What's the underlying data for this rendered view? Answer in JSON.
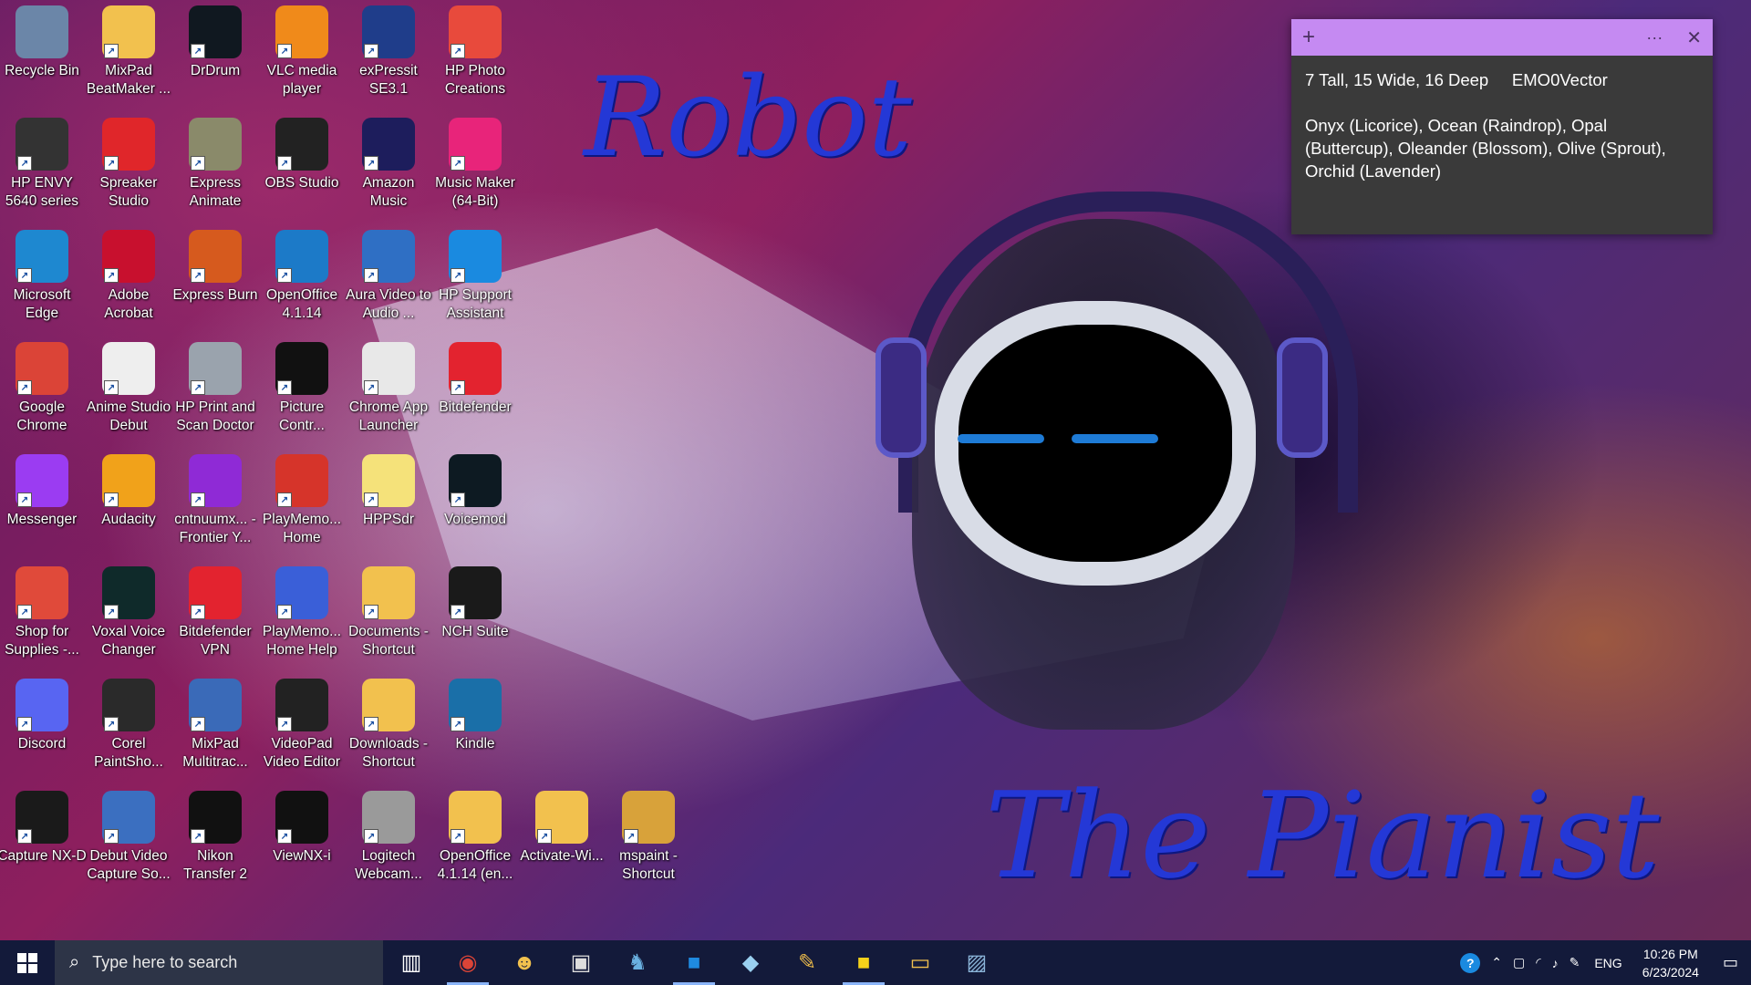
{
  "desktop": {
    "icons": [
      {
        "label": "Recycle Bin",
        "icon": "recycle-bin-icon",
        "color": "#6b86a8"
      },
      {
        "label": "MixPad BeatMaker ...",
        "icon": "folder-icon",
        "color": "#f2c14e"
      },
      {
        "label": "DrDrum",
        "icon": "drdrum-icon",
        "color": "#101820"
      },
      {
        "label": "VLC media player",
        "icon": "vlc-cone-icon",
        "color": "#f08a1a"
      },
      {
        "label": "exPressit SE3.1",
        "icon": "expressit-icon",
        "color": "#1f3d8a"
      },
      {
        "label": "HP Photo Creations",
        "icon": "hp-photo-icon",
        "color": "#e84a3c"
      },
      {
        "label": "HP ENVY 5640 series",
        "icon": "printer-icon",
        "color": "#333333"
      },
      {
        "label": "Spreaker Studio",
        "icon": "rec-icon",
        "color": "#e0262a"
      },
      {
        "label": "Express Animate",
        "icon": "express-animate-icon",
        "color": "#8a8a6a"
      },
      {
        "label": "OBS Studio",
        "icon": "obs-icon",
        "color": "#222222"
      },
      {
        "label": "Amazon Music",
        "icon": "amazon-music-icon",
        "color": "#1d1d5c"
      },
      {
        "label": "Music Maker (64-Bit)",
        "icon": "music-maker-icon",
        "color": "#e8247a"
      },
      {
        "label": "Microsoft Edge",
        "icon": "edge-icon",
        "color": "#1e88d0"
      },
      {
        "label": "Adobe Acrobat",
        "icon": "acrobat-icon",
        "color": "#c8102e"
      },
      {
        "label": "Express Burn",
        "icon": "express-burn-icon",
        "color": "#d65a1e"
      },
      {
        "label": "OpenOffice 4.1.14",
        "icon": "openoffice-icon",
        "color": "#1c7ac8"
      },
      {
        "label": "Aura Video to Audio ...",
        "icon": "aura-video-icon",
        "color": "#2f6fc4"
      },
      {
        "label": "HP Support Assistant",
        "icon": "help-question-icon",
        "color": "#1a8ae0"
      },
      {
        "label": "Google Chrome",
        "icon": "chrome-icon",
        "color": "#db4437"
      },
      {
        "label": "Anime Studio Debut",
        "icon": "anime-studio-icon",
        "color": "#eeeeee"
      },
      {
        "label": "HP Print and Scan Doctor",
        "icon": "hp-doctor-icon",
        "color": "#9aa3ad"
      },
      {
        "label": "Picture Contr...",
        "icon": "nikon-picture-control-icon",
        "color": "#111111"
      },
      {
        "label": "Chrome App Launcher",
        "icon": "app-launcher-icon",
        "color": "#e8e8e8"
      },
      {
        "label": "Bitdefender",
        "icon": "bitdefender-icon",
        "color": "#e3232f"
      },
      {
        "label": "Messenger",
        "icon": "messenger-icon",
        "color": "#9b3cf2"
      },
      {
        "label": "Audacity",
        "icon": "audacity-icon",
        "color": "#f1a21a"
      },
      {
        "label": "cntnuumx... - Frontier Y...",
        "icon": "mail-envelope-icon",
        "color": "#8f2ad6"
      },
      {
        "label": "PlayMemo... Home",
        "icon": "playmemories-icon",
        "color": "#d6342a"
      },
      {
        "label": "HPPSdr",
        "icon": "hppsdr-icon",
        "color": "#f5e27a"
      },
      {
        "label": "Voicemod",
        "icon": "voicemod-icon",
        "color": "#0d1a22"
      },
      {
        "label": "Shop for Supplies -...",
        "icon": "shop-printer-icon",
        "color": "#e04a3a"
      },
      {
        "label": "Voxal Voice Changer",
        "icon": "voxal-icon",
        "color": "#0f2a2a"
      },
      {
        "label": "Bitdefender VPN",
        "icon": "bitdefender-vpn-icon",
        "color": "#e3232f"
      },
      {
        "label": "PlayMemo... Home Help",
        "icon": "help-question-icon",
        "color": "#3a5fd8"
      },
      {
        "label": "Documents - Shortcut",
        "icon": "documents-folder-icon",
        "color": "#f2c14e"
      },
      {
        "label": "NCH Suite",
        "icon": "nch-icon",
        "color": "#1a1a1a"
      },
      {
        "label": "Discord",
        "icon": "discord-icon",
        "color": "#5865f2"
      },
      {
        "label": "Corel PaintSho...",
        "icon": "camera-icon",
        "color": "#2a2a2a"
      },
      {
        "label": "MixPad Multitrac...",
        "icon": "mixpad-icon",
        "color": "#3a6ab8"
      },
      {
        "label": "VideoPad Video Editor",
        "icon": "videopad-star-icon",
        "color": "#222222"
      },
      {
        "label": "Downloads - Shortcut",
        "icon": "downloads-folder-icon",
        "color": "#f2c14e"
      },
      {
        "label": "Kindle",
        "icon": "kindle-icon",
        "color": "#1a6fa8"
      },
      {
        "label": "Capture NX-D",
        "icon": "capture-nxd-icon",
        "color": "#1a1a1a"
      },
      {
        "label": "Debut Video Capture So...",
        "icon": "film-icon",
        "color": "#3b6fc0"
      },
      {
        "label": "Nikon Transfer 2",
        "icon": "nikon-transfer-icon",
        "color": "#111111"
      },
      {
        "label": "ViewNX-i",
        "icon": "viewnx-icon",
        "color": "#111111"
      },
      {
        "label": "Logitech Webcam...",
        "icon": "webcam-icon",
        "color": "#9a9a9a"
      },
      {
        "label": "OpenOffice 4.1.14 (en...",
        "icon": "folder-icon",
        "color": "#f2c14e"
      },
      {
        "label": "Activate-Wi...",
        "icon": "folder-icon",
        "color": "#f2c14e"
      },
      {
        "label": "mspaint - Shortcut",
        "icon": "paint-brushes-icon",
        "color": "#d8a23a"
      }
    ]
  },
  "wallpaper": {
    "title_top": "Robot",
    "title_bottom": "The Pianist"
  },
  "sticky_note": {
    "add_label": "+",
    "menu_label": "···",
    "close_label": "✕",
    "line1": "7 Tall, 15 Wide, 16 Deep     EMO0Vector",
    "line2": "Onyx (Licorice), Ocean (Raindrop), Opal (Buttercup), Oleander (Blossom), Olive (Sprout), Orchid (Lavender)",
    "bar_color": "#c58af2"
  },
  "taskbar": {
    "search_placeholder": "Type here to search",
    "apps": [
      {
        "name": "task-view-icon",
        "glyph": "▥",
        "color": "#ffffff"
      },
      {
        "name": "chrome-icon",
        "glyph": "◉",
        "color": "#db4437"
      },
      {
        "name": "character-app-icon",
        "glyph": "☻",
        "color": "#f2c14e"
      },
      {
        "name": "photo-app-icon",
        "glyph": "▣",
        "color": "#dddddd"
      },
      {
        "name": "kindle-icon",
        "glyph": "♞",
        "color": "#6ab0e0"
      },
      {
        "name": "blue-app-icon",
        "glyph": "■",
        "color": "#1f8ae0"
      },
      {
        "name": "feather-app-icon",
        "glyph": "◆",
        "color": "#9ad0f0"
      },
      {
        "name": "paint-brushes-icon",
        "glyph": "✎",
        "color": "#e8b84a"
      },
      {
        "name": "sticky-notes-icon",
        "glyph": "■",
        "color": "#f5d21a"
      },
      {
        "name": "file-explorer-icon",
        "glyph": "▭",
        "color": "#f2c14e"
      },
      {
        "name": "image-viewer-icon",
        "glyph": "▨",
        "color": "#8ab4d8"
      }
    ],
    "tray": {
      "language": "ENG",
      "time": "10:26 PM",
      "date": "6/23/2024"
    }
  }
}
